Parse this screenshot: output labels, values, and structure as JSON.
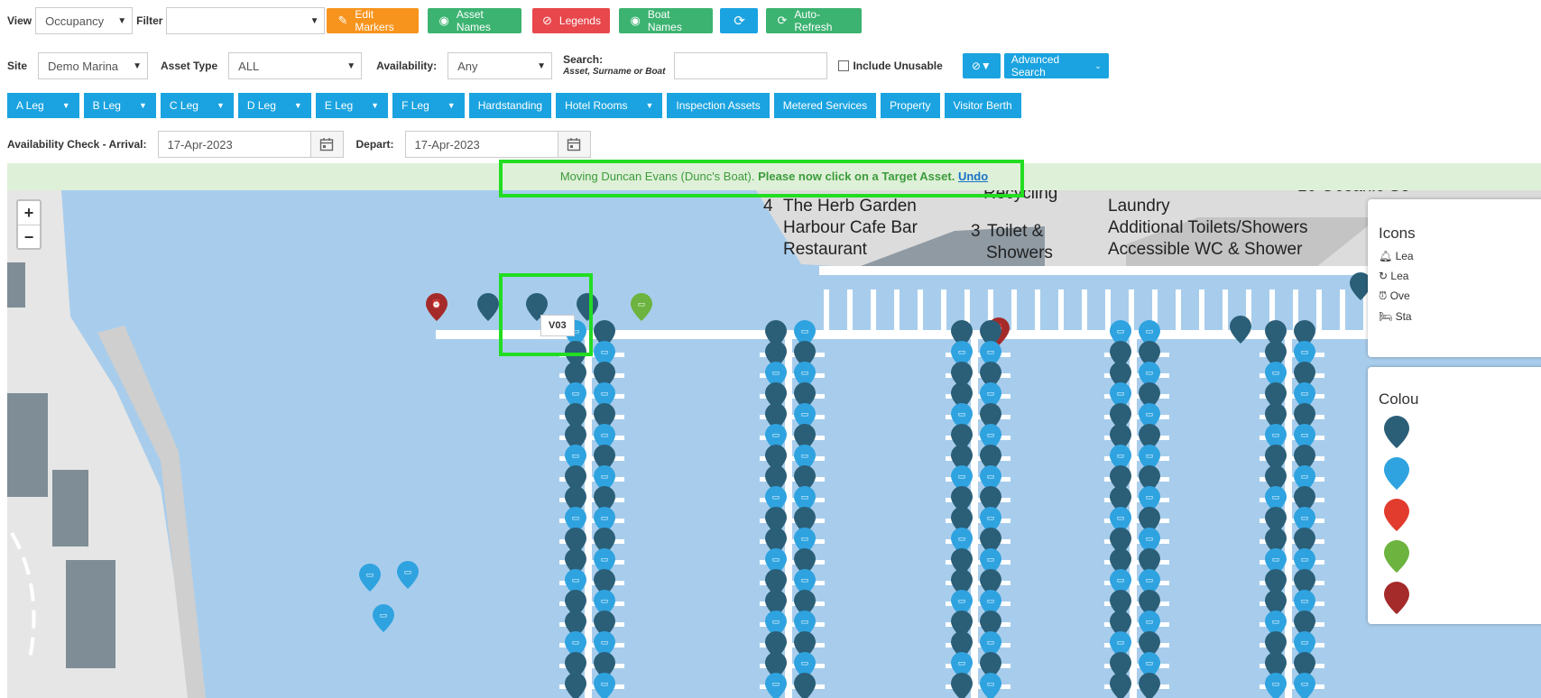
{
  "toolbar": {
    "view_label": "View",
    "view_value": "Occupancy",
    "filter_label": "Filter",
    "filter_value": "",
    "edit_markers": "Edit Markers",
    "asset_names": "Asset Names",
    "legends": "Legends",
    "boat_names": "Boat Names",
    "auto_refresh": "Auto-Refresh"
  },
  "search": {
    "site_label": "Site",
    "site_value": "Demo Marina",
    "asset_type_label": "Asset Type",
    "asset_type_value": "ALL",
    "availability_label": "Availability:",
    "availability_value": "Any",
    "search_label": "Search:",
    "search_hint": "Asset, Surname or Boat",
    "search_value": "",
    "include_unusable": "Include Unusable",
    "advanced_search": "Advanced Search"
  },
  "legs": [
    "A Leg",
    "B Leg",
    "C Leg",
    "D Leg",
    "E Leg",
    "F Leg",
    "Hardstanding",
    "Hotel Rooms",
    "Inspection Assets",
    "Metered Services",
    "Property",
    "Visitor Berth"
  ],
  "legs_with_caret": [
    true,
    true,
    true,
    true,
    true,
    true,
    false,
    true,
    false,
    false,
    false,
    false
  ],
  "availability_check": {
    "arrival_label": "Availability Check - Arrival:",
    "arrival_value": "17-Apr-2023",
    "depart_label": "Depart:",
    "depart_value": "17-Apr-2023"
  },
  "banner": {
    "moving_text": "Moving Duncan Evans (Dunc's Boat).",
    "instruction": "Please now click on a Target Asset.",
    "undo": "Undo"
  },
  "map": {
    "zoom_in": "+",
    "zoom_out": "−",
    "tooltip": "V03",
    "labels": {
      "recycling": "Recycling",
      "herb_garden": "The Herb Garden",
      "herb_num": "4",
      "harbour_cafe": "Harbour Cafe Bar",
      "restaurant": "Restaurant",
      "toilet_num": "3",
      "toilet": "Toilet &",
      "showers": "Showers",
      "laundry": "Laundry",
      "additional": "Additional Toilets/Showers",
      "accessible": "Accessible WC & Shower",
      "oceanic": "10 Oceanic So"
    },
    "icons_title": "Icons",
    "icons_items": [
      "Lea",
      "Lea",
      "Ove",
      "Sta"
    ],
    "colours_title": "Colou"
  },
  "colors": {
    "dark_pin": "#2b5f78",
    "light_pin": "#2fa3e0",
    "red_pin": "#c0393b",
    "green_pin": "#6cb33f",
    "maroon_pin": "#a52a2a",
    "water": "#a8cdec",
    "highlight": "#22dd22"
  }
}
